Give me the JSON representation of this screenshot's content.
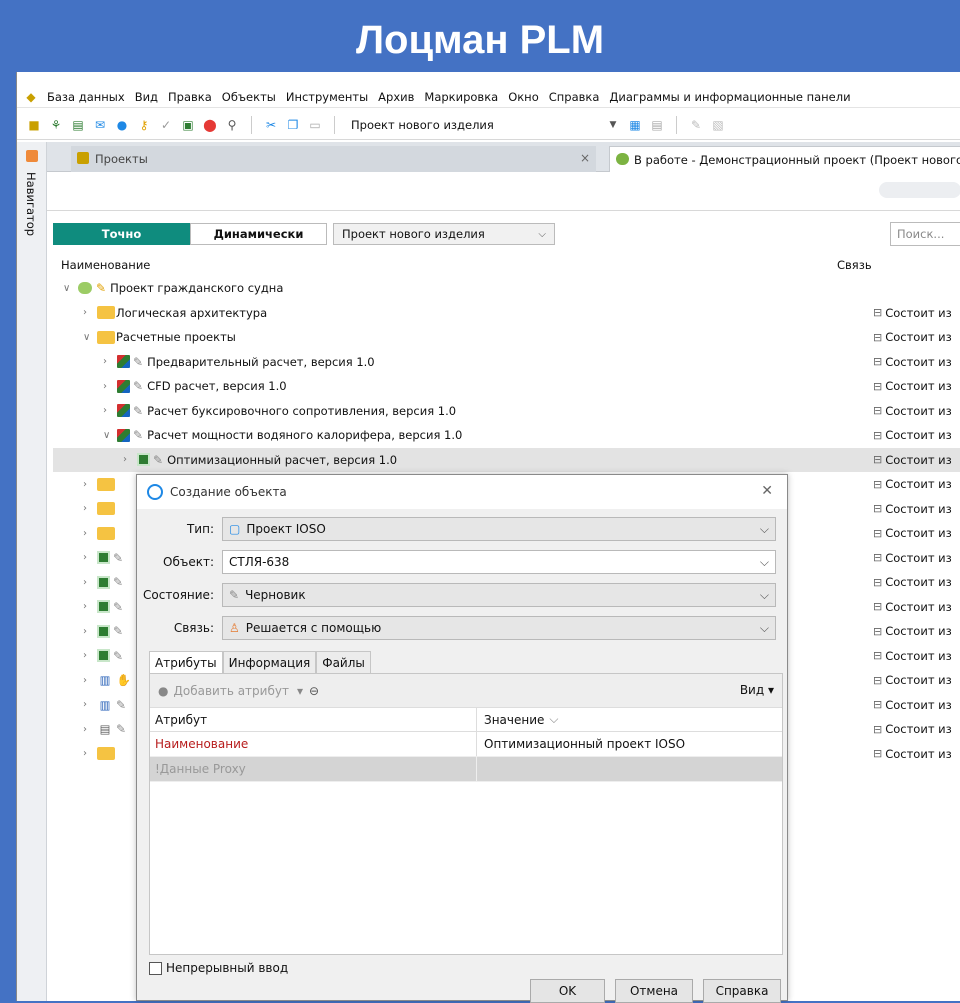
{
  "banner": {
    "title": "Лоцман PLM"
  },
  "menu": [
    "База данных",
    "Вид",
    "Правка",
    "Объекты",
    "Инструменты",
    "Архив",
    "Маркировка",
    "Окно",
    "Справка",
    "Диаграммы и информационные панели"
  ],
  "toolbar": {
    "combo_value": "Проект нового изделия"
  },
  "sidebar": {
    "label": "Навигатор"
  },
  "tabs": [
    {
      "label": "Проекты"
    },
    {
      "label": "В работе - Демонстрационный проект (Проект нового"
    }
  ],
  "filter": {
    "exact": "Точно",
    "dynamic": "Динамически",
    "project": "Проект нового изделия",
    "search_placeholder": "Поиск..."
  },
  "columns": {
    "name": "Наименование",
    "link": "Связь"
  },
  "tree": [
    {
      "label": "Проект гражданского судна",
      "link": ""
    },
    {
      "label": "Логическая архитектура",
      "link": "Состоит из"
    },
    {
      "label": "Расчетные проекты",
      "link": "Состоит из"
    },
    {
      "label": "Предварительный расчет, версия 1.0",
      "link": "Состоит из"
    },
    {
      "label": "CFD расчет, версия 1.0",
      "link": "Состоит из"
    },
    {
      "label": "Расчет буксировочного сопротивления, версия 1.0",
      "link": "Состоит из"
    },
    {
      "label": "Расчет мощности водяного калорифера, версия 1.0",
      "link": "Состоит из"
    },
    {
      "label": "Оптимизационный расчет, версия 1.0",
      "link": "Состоит из"
    },
    {
      "label": "",
      "link": "Состоит из"
    },
    {
      "label": "",
      "link": "Состоит из"
    },
    {
      "label": "",
      "link": "Состоит из"
    },
    {
      "label": "",
      "link": "Состоит из"
    },
    {
      "label": "",
      "link": "Состоит из"
    },
    {
      "label": "",
      "link": "Состоит из"
    },
    {
      "label": "",
      "link": "Состоит из"
    },
    {
      "label": "",
      "link": "Состоит из"
    },
    {
      "label": "",
      "link": "Состоит из"
    },
    {
      "label": "",
      "link": "Состоит из"
    },
    {
      "label": "",
      "link": "Состоит из"
    },
    {
      "label": "",
      "link": "Состоит из"
    }
  ],
  "dialog": {
    "title": "Создание объекта",
    "type_label": "Тип:",
    "type_value": "Проект IOSO",
    "object_label": "Объект:",
    "object_value": "СТЛЯ-638",
    "state_label": "Состояние:",
    "state_value": "Черновик",
    "link_label": "Связь:",
    "link_value": "Решается с помощью",
    "tabs": [
      "Атрибуты",
      "Информация",
      "Файлы"
    ],
    "add_attr": "Добавить атрибут",
    "view": "Вид",
    "col_attr": "Атрибут",
    "col_value": "Значение",
    "rows": [
      {
        "attr": "Наименование",
        "value": "Оптимизационный проект IOSO"
      },
      {
        "attr": "!Данные Proxy",
        "value": ""
      }
    ],
    "continuous": "Непрерывный ввод",
    "ok": "OK",
    "cancel": "Отмена",
    "help": "Справка"
  }
}
